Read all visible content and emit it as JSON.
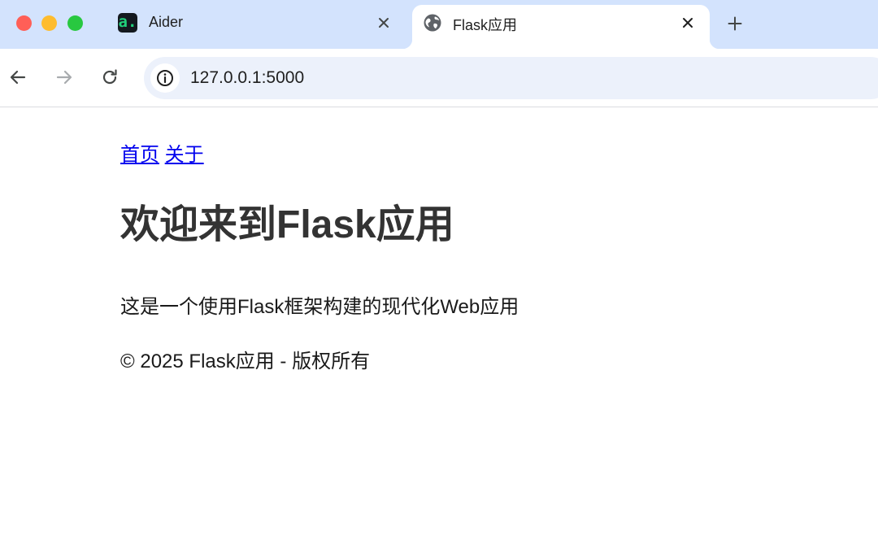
{
  "browser": {
    "tabs": [
      {
        "title": "Aider",
        "favicon": "aider-logo-icon",
        "active": false
      },
      {
        "title": "Flask应用",
        "favicon": "globe-icon",
        "active": true
      }
    ],
    "aider_favicon_glyph": "a.",
    "url": "127.0.0.1:5000",
    "colors": {
      "tabstrip_bg": "#d3e3fd",
      "omnibox_bg": "#ecf1fb",
      "traffic_red": "#ff5f57",
      "traffic_yellow": "#febc2e",
      "traffic_green": "#28c840"
    }
  },
  "page": {
    "nav": [
      {
        "label": "首页"
      },
      {
        "label": "关于"
      }
    ],
    "heading": "欢迎来到Flask应用",
    "description": "这是一个使用Flask框架构建的现代化Web应用",
    "footer": "© 2025 Flask应用 - 版权所有",
    "link_color": "#0000ee"
  }
}
